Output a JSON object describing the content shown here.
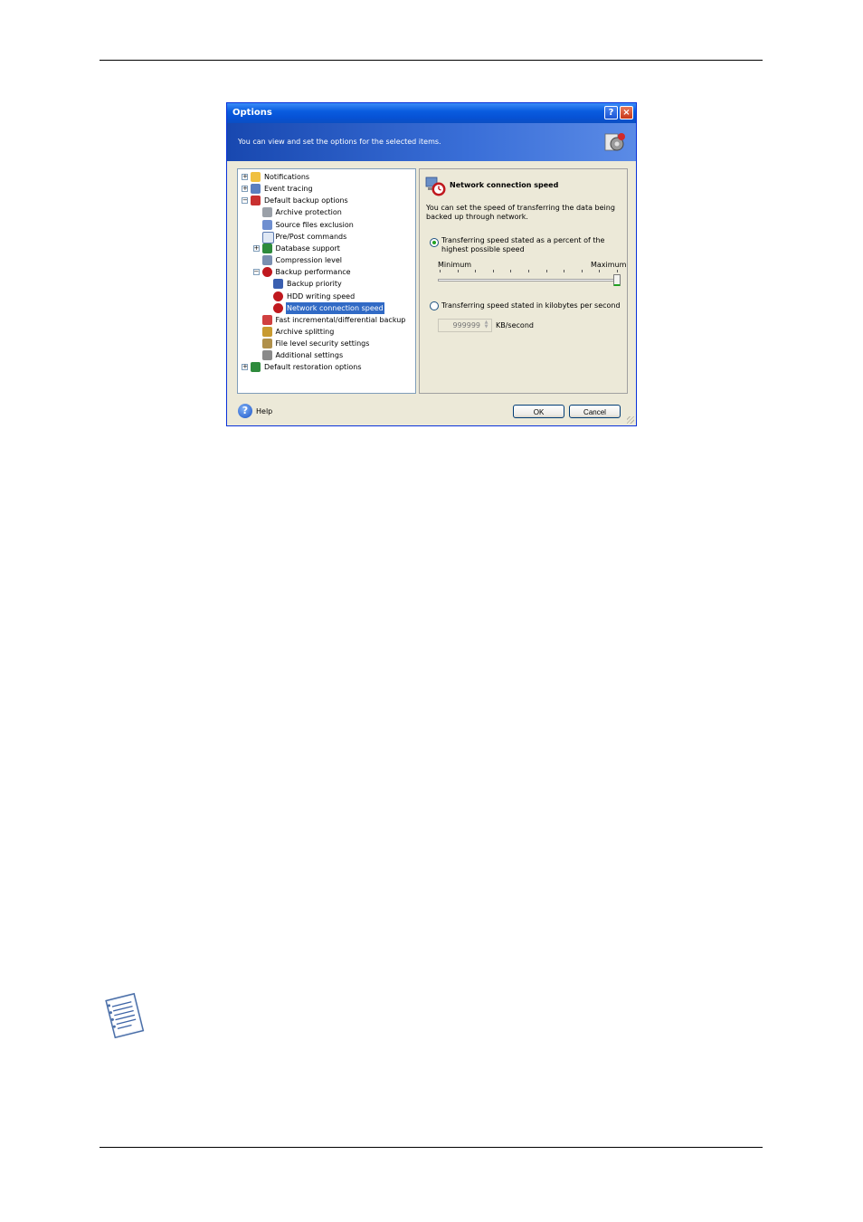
{
  "dialog": {
    "title": "Options",
    "header_text": "You can view and set the options for the selected items.",
    "help_button_glyph": "?",
    "close_button_glyph": "×"
  },
  "tree": {
    "items": [
      {
        "label": "Notifications",
        "expander": "+",
        "icon": "notifications-icon"
      },
      {
        "label": "Event tracing",
        "expander": "+",
        "icon": "event-tracing-icon"
      },
      {
        "label": "Default backup options",
        "expander": "−",
        "icon": "backup-options-icon"
      },
      {
        "label": "Archive protection",
        "icon": "lock-icon"
      },
      {
        "label": "Source files exclusion",
        "icon": "exclusion-icon"
      },
      {
        "label": "Pre/Post commands",
        "icon": "commands-icon"
      },
      {
        "label": "Database support",
        "expander": "+",
        "icon": "database-icon"
      },
      {
        "label": "Compression level",
        "icon": "compression-icon"
      },
      {
        "label": "Backup performance",
        "expander": "−",
        "icon": "performance-icon"
      },
      {
        "label": "Backup priority",
        "icon": "priority-icon"
      },
      {
        "label": "HDD writing speed",
        "icon": "hdd-speed-icon"
      },
      {
        "label": "Network connection speed",
        "icon": "network-speed-icon",
        "selected": true
      },
      {
        "label": "Fast incremental/differential backup",
        "icon": "incremental-icon"
      },
      {
        "label": "Archive splitting",
        "icon": "splitting-icon"
      },
      {
        "label": "File level security settings",
        "icon": "security-icon"
      },
      {
        "label": "Additional settings",
        "icon": "additional-settings-icon"
      },
      {
        "label": "Default restoration options",
        "expander": "+",
        "icon": "restoration-icon"
      }
    ]
  },
  "panel": {
    "title": "Network connection speed",
    "description": "You can set the speed of transferring the data being backed up through network.",
    "option_percent": "Transferring speed stated as a percent of the highest possible speed",
    "slider_min": "Minimum",
    "slider_max": "Maximum",
    "slider_value": 1.0,
    "option_kbps": "Transferring speed stated in kilobytes per second",
    "kbps_value": "999999",
    "kbps_unit": "KB/second"
  },
  "footer": {
    "help_label": "Help",
    "ok_label": "OK",
    "cancel_label": "Cancel"
  },
  "colors": {
    "title_bar": "#0a5ddf",
    "selection": "#316ac5",
    "slider_accent": "#21a121"
  }
}
